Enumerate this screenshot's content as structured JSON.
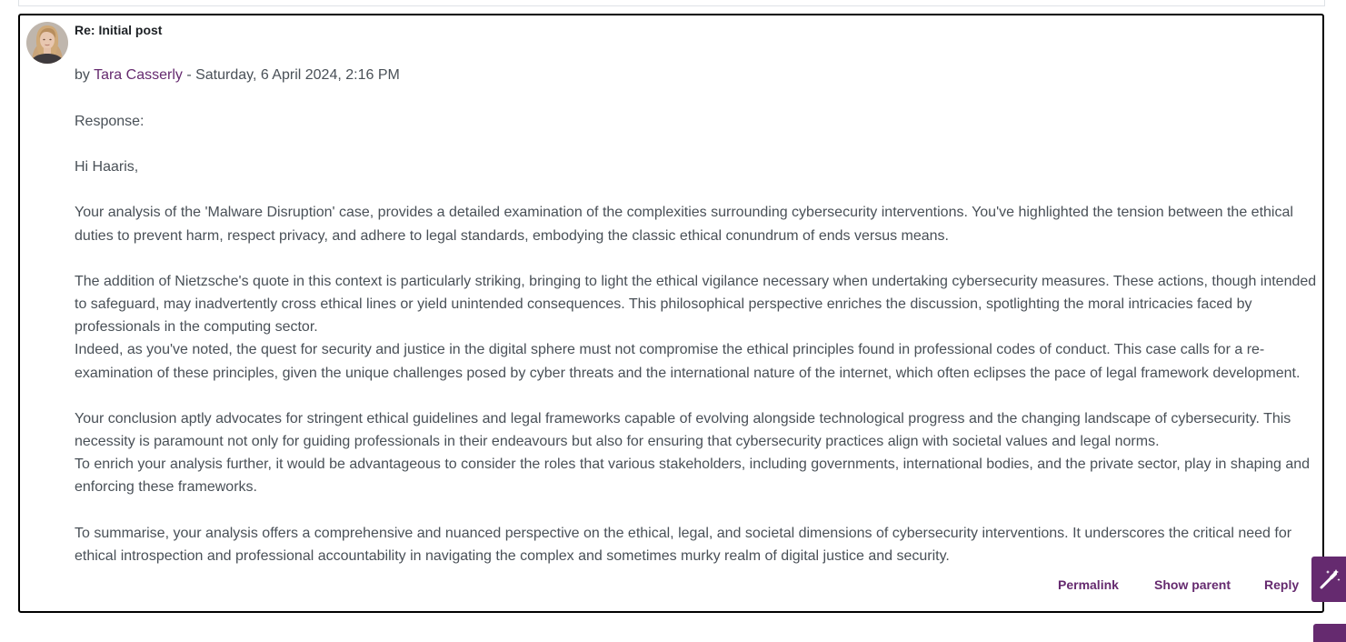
{
  "post": {
    "subject": "Re: Initial post",
    "by_prefix": "by ",
    "author": "Tara Casserly",
    "date_separator": " - ",
    "date": "Saturday, 6 April 2024, 2:16 PM",
    "paragraphs": [
      "Response:",
      "Hi Haaris,",
      "Your analysis of the 'Malware Disruption' case, provides a detailed examination of the complexities surrounding cybersecurity interventions. You've highlighted the tension between the ethical duties to prevent harm, respect privacy, and adhere to legal standards, embodying the classic ethical conundrum of ends versus means.",
      "The addition of Nietzsche's quote in this context is particularly striking, bringing to light the ethical vigilance necessary when undertaking cybersecurity measures. These actions, though intended to safeguard, may inadvertently cross ethical lines or yield unintended consequences. This philosophical perspective enriches the discussion, spotlighting the moral intricacies faced by professionals in the computing sector.",
      "Indeed, as you've noted, the quest for security and justice in the digital sphere must not compromise the ethical principles found in professional codes of conduct. This case calls for a re-examination of these principles, given the unique challenges posed by cyber threats and the international nature of the internet, which often eclipses the pace of legal framework development.",
      "Your conclusion aptly advocates for stringent ethical guidelines and legal frameworks capable of evolving alongside technological progress and the changing landscape of cybersecurity. This necessity is paramount not only for guiding professionals in their endeavours but also for ensuring that cybersecurity practices align with societal values and legal norms.",
      "To enrich your analysis further, it would be advantageous to consider the roles that various stakeholders, including governments, international bodies, and the private sector, play in shaping and enforcing these frameworks.",
      "To summarise, your analysis offers a comprehensive and nuanced perspective on the ethical, legal, and societal dimensions of cybersecurity interventions. It underscores the critical need for ethical introspection and professional accountability in navigating the complex and sometimes murky realm of digital justice and security."
    ]
  },
  "actions": {
    "permalink": "Permalink",
    "show_parent": "Show parent",
    "reply": "Reply"
  },
  "icons": {
    "avatar": "user-avatar-photo",
    "floating_tool": "magic-wand-icon"
  },
  "colors": {
    "link": "#652a6f",
    "text": "#495057",
    "accent": "#652a6f",
    "border": "#000000"
  }
}
